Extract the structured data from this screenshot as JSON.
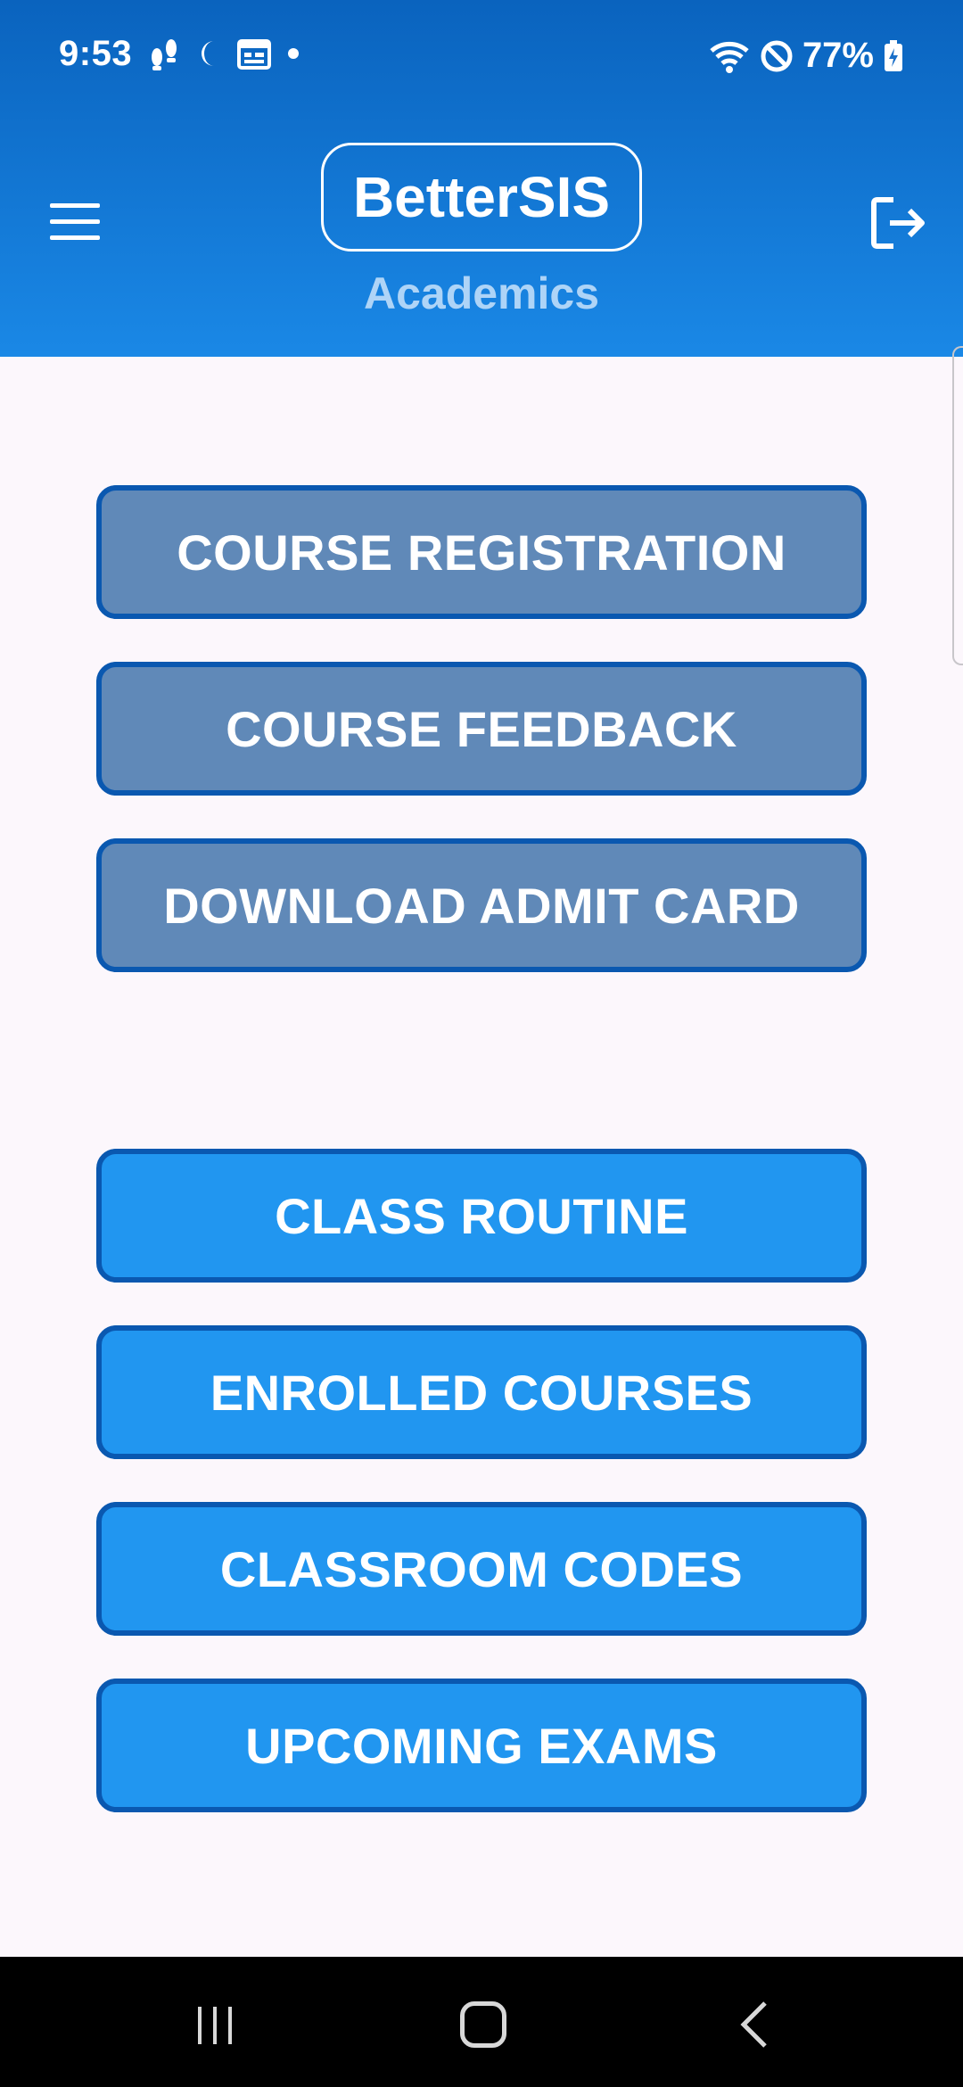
{
  "status_bar": {
    "time": "9:53",
    "battery": "77%",
    "icons": [
      "step-counter-icon",
      "moon-icon",
      "calendar-icon",
      "dot-icon",
      "wifi-icon",
      "do-not-disturb-icon",
      "battery-charging-icon"
    ]
  },
  "header": {
    "title": "BetterSIS",
    "subtitle": "Academics",
    "menu_icon": "hamburger-menu-icon",
    "logout_icon": "logout-icon"
  },
  "buttons_group_1": [
    {
      "label": "COURSE REGISTRATION"
    },
    {
      "label": "COURSE FEEDBACK"
    },
    {
      "label": "DOWNLOAD ADMIT CARD"
    }
  ],
  "buttons_group_2": [
    {
      "label": "CLASS ROUTINE"
    },
    {
      "label": "ENROLLED COURSES"
    },
    {
      "label": "CLASSROOM CODES"
    },
    {
      "label": "UPCOMING EXAMS"
    }
  ],
  "nav_bar": {
    "recent_icon": "recent-apps-icon",
    "home_icon": "home-icon",
    "back_icon": "back-icon"
  },
  "colors": {
    "header_top": "#0a63be",
    "header_bottom": "#1a88e6",
    "muted_button": "#6089b8",
    "active_button": "#2196f0",
    "button_border": "#0a58b0",
    "subtitle": "#aed4f7",
    "background": "#fcf7fc"
  }
}
